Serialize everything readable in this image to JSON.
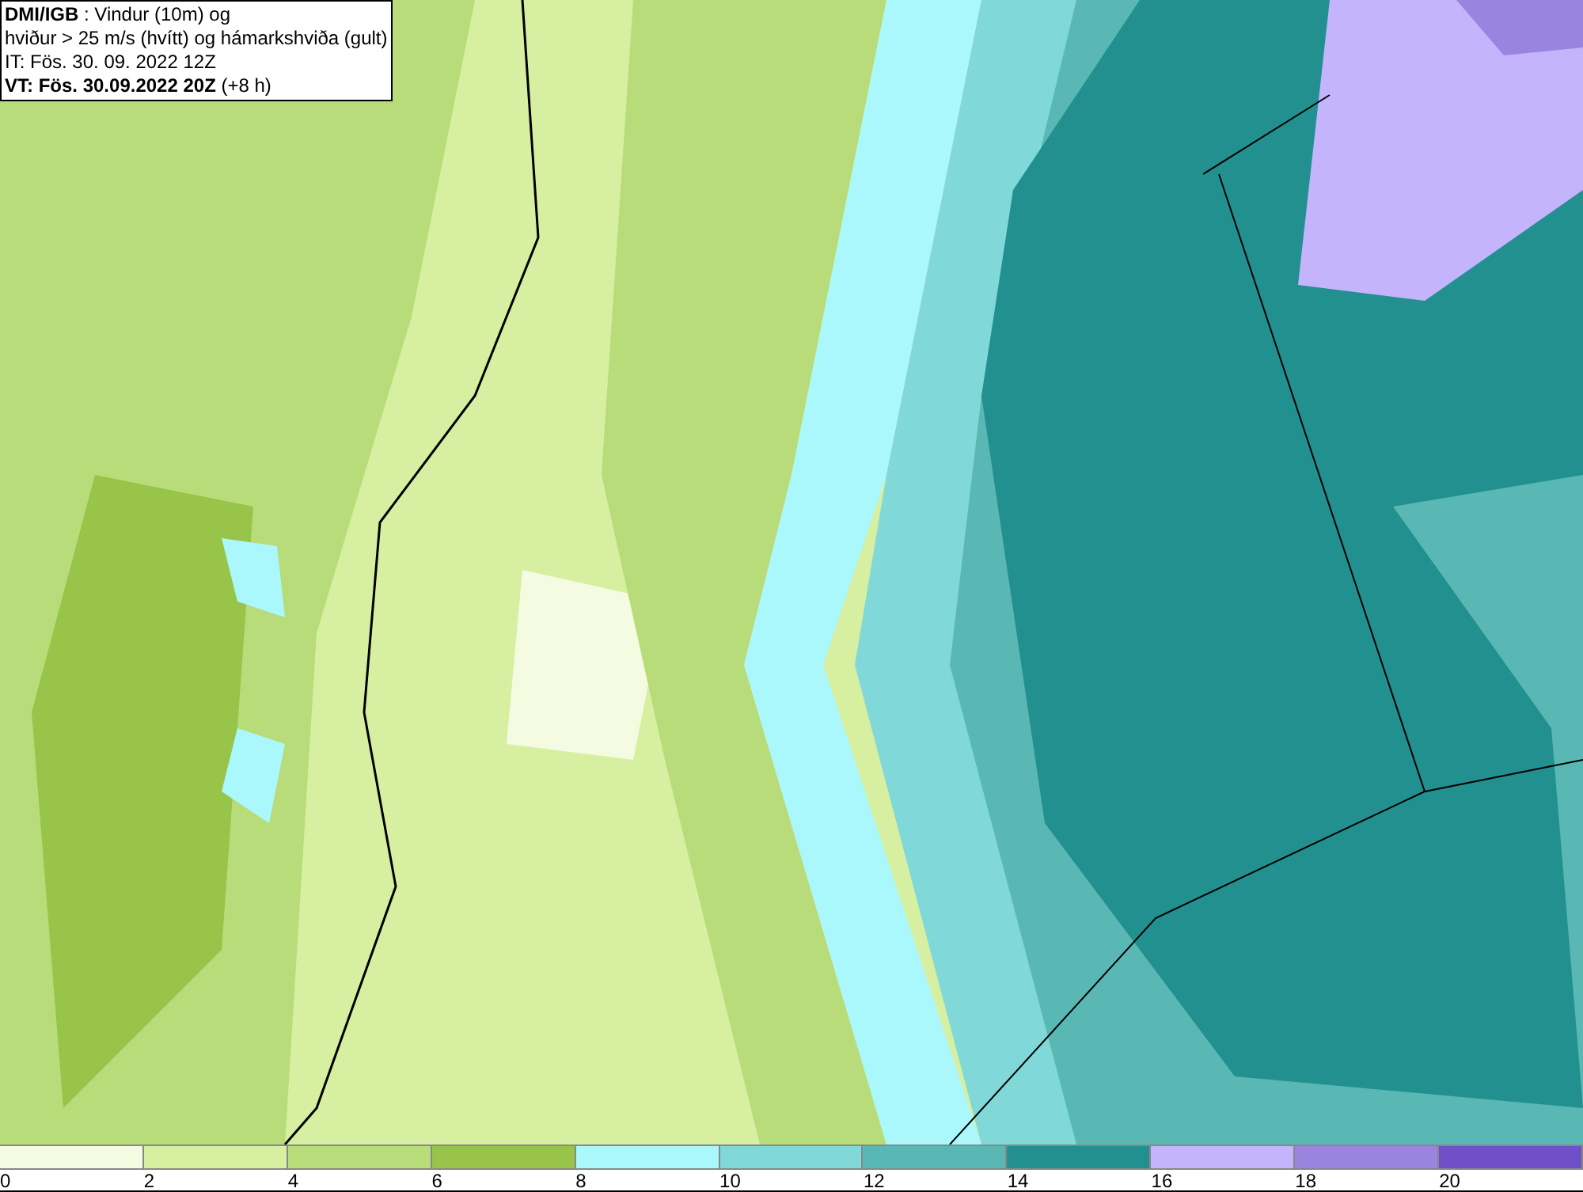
{
  "title_box": {
    "lines": [
      "**DMI/IGB** : Vindur (10m) og",
      "hviður > 25 m/s (hvítt) og hámarkshviða (gult)",
      "IT: Fös. 30. 09. 2022 12Z",
      "**VT: Fös. 30.09.2022 20Z** (+8 h)"
    ]
  },
  "legend": {
    "bins": [
      {
        "color": "#f5fbe0"
      },
      {
        "color": "#d6efa0"
      },
      {
        "color": "#b8dc7a"
      },
      {
        "color": "#98c44a"
      },
      {
        "color": "#aaf8fb"
      },
      {
        "color": "#80d8d8"
      },
      {
        "color": "#5ab8b4"
      },
      {
        "color": "#239090"
      },
      {
        "color": "#c4b4fb"
      },
      {
        "color": "#9a84e0"
      },
      {
        "color": "#7050c8"
      }
    ],
    "ticks": [
      "0",
      "2",
      "4",
      "6",
      "8",
      "10",
      "12",
      "14",
      "16",
      "18",
      "20"
    ]
  }
}
